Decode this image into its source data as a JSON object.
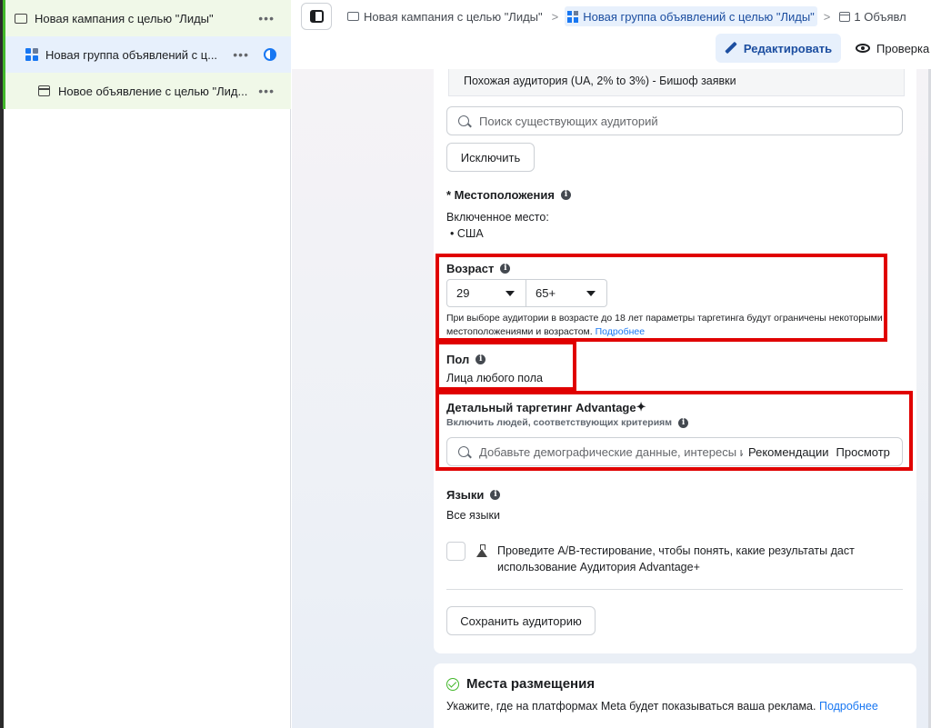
{
  "colors": {
    "accent": "#1877f2",
    "highlight": "#e00000",
    "success": "#42b72a"
  },
  "sidebar": {
    "items": [
      {
        "label": "Новая кампания с целью \"Лиды\"",
        "icon": "folder-icon",
        "more": "•••"
      },
      {
        "label": "Новая группа объявлений с ц...",
        "icon": "ad-set-grid-icon",
        "more": "•••"
      },
      {
        "label": "Новое объявление с целью \"Лид...",
        "icon": "ad-icon",
        "more": "•••"
      }
    ]
  },
  "breadcrumb": {
    "campaign": "Новая кампания с целью \"Лиды\"",
    "adset": "Новая группа объявлений с целью \"Лиды\"",
    "ad": "1 Объявл",
    "separator": ">"
  },
  "toolbar": {
    "edit_label": "Редактировать",
    "review_label": "Проверка"
  },
  "audience": {
    "lookalike": "Похожая аудитория (UA, 2% to 3%) - Бишоф заявки",
    "search_placeholder": "Поиск существующих аудиторий",
    "exclude_label": "Исключить"
  },
  "locations": {
    "title": "* Местоположения",
    "included_label": "Включенное место:",
    "items": [
      "• США"
    ]
  },
  "age": {
    "title": "Возраст",
    "min": "29",
    "max": "65+",
    "note": "При выборе аудитории в возрасте до 18 лет параметры таргетинга будут ограничены некоторыми местоположениями и возрастом.",
    "note_link": "Подробнее"
  },
  "gender": {
    "title": "Пол",
    "value": "Лица любого пола"
  },
  "detailed": {
    "title": "Детальный таргетинг Advantage",
    "title_symbol": "✦",
    "subtitle": "Включить людей, соответствующих критериям",
    "placeholder": "Добавьте демографические данные, интересы или м",
    "recommendations": "Рекомендации",
    "browse": "Просмотр"
  },
  "languages": {
    "title": "Языки",
    "value": "Все языки"
  },
  "ab_test": {
    "text": "Проведите A/B-тестирование, чтобы понять, какие результаты даст использование Аудитория Advantage+"
  },
  "save_audience_label": "Сохранить аудиторию",
  "placements": {
    "title": "Места размещения",
    "description": "Укажите, где на платформах Meta будет показываться ваша реклама.",
    "link": "Подробнее"
  }
}
